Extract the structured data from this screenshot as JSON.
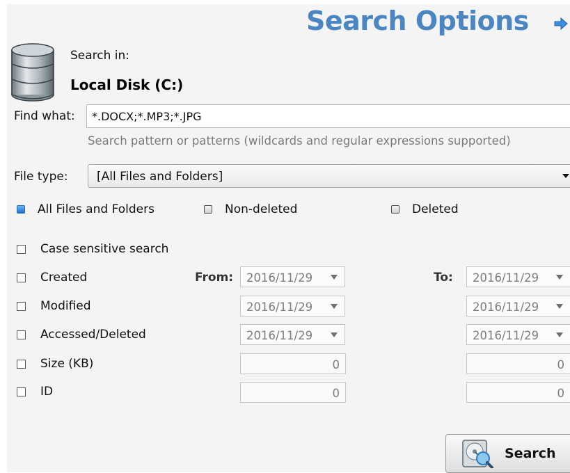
{
  "header": {
    "title": "Search Options",
    "arrow_icon": "arrow-right-icon",
    "title_color": "#4b86c2"
  },
  "location": {
    "icon": "database-icon",
    "label": "Search in:",
    "value": "Local Disk (C:)"
  },
  "find": {
    "label": "Find what:",
    "value": "*.DOCX;*.MP3;*.JPG",
    "hint": "Search pattern or patterns (wildcards and regular expressions supported)"
  },
  "file_type": {
    "label": "File type:",
    "selected": "[All Files and Folders]"
  },
  "scope_options": [
    {
      "label": "All Files and Folders",
      "selected": true
    },
    {
      "label": "Non-deleted",
      "selected": false
    },
    {
      "label": "Deleted",
      "selected": false
    }
  ],
  "filters": {
    "case_sensitive": {
      "label": "Case sensitive search",
      "checked": false
    },
    "from_label": "From:",
    "to_label": "To:",
    "rows": [
      {
        "label": "Created",
        "checked": false,
        "from": "2016/11/29",
        "to": "2016/11/29"
      },
      {
        "label": "Modified",
        "checked": false,
        "from": "2016/11/29",
        "to": "2016/11/29"
      },
      {
        "label": "Accessed/Deleted",
        "checked": false,
        "from": "2016/11/29",
        "to": "2016/11/29"
      },
      {
        "label": "Size (KB)",
        "checked": false,
        "from": "0",
        "to": "0"
      },
      {
        "label": "ID",
        "checked": false,
        "from": "0",
        "to": "0"
      }
    ]
  },
  "search_button": {
    "label": "Search",
    "icon": "hard-disk-search-icon"
  }
}
